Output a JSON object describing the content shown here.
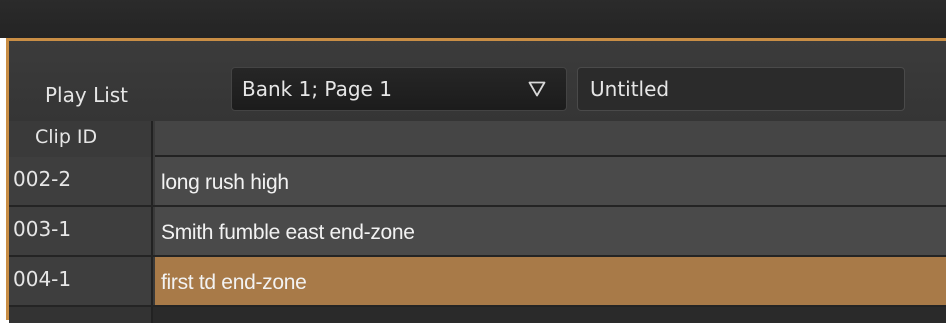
{
  "header": {
    "label": "Play List",
    "bank_select": {
      "value": "Bank 1; Page 1",
      "icon": "chevron-down-icon"
    },
    "title_field": {
      "value": "Untitled"
    }
  },
  "table": {
    "columns": [
      "Clip ID",
      ""
    ],
    "rows": [
      {
        "clip_id": "002-2",
        "description": "long rush high",
        "selected": false
      },
      {
        "clip_id": "003-1",
        "description": "Smith fumble east end-zone",
        "selected": false
      },
      {
        "clip_id": "004-1",
        "description": "first td end-zone",
        "selected": true
      }
    ]
  },
  "colors": {
    "accent": "#c98e45",
    "selected_row": "#a87a48"
  }
}
